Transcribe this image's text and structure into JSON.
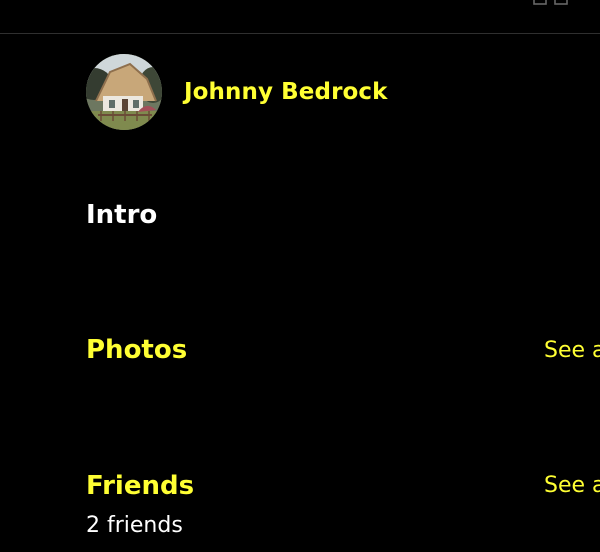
{
  "colors": {
    "background": "#000000",
    "accent": "#ffff33",
    "text": "#ffffff",
    "divider": "#2f2f2f"
  },
  "header": {
    "icon": "window-controls-icon"
  },
  "profile": {
    "name": "Johnny Bedrock",
    "avatar_icon": "cottage-avatar-image"
  },
  "sections": {
    "intro": {
      "title": "Intro"
    },
    "photos": {
      "title": "Photos",
      "see_all": "See all"
    },
    "friends": {
      "title": "Friends",
      "see_all": "See all",
      "count": "2 friends"
    }
  }
}
